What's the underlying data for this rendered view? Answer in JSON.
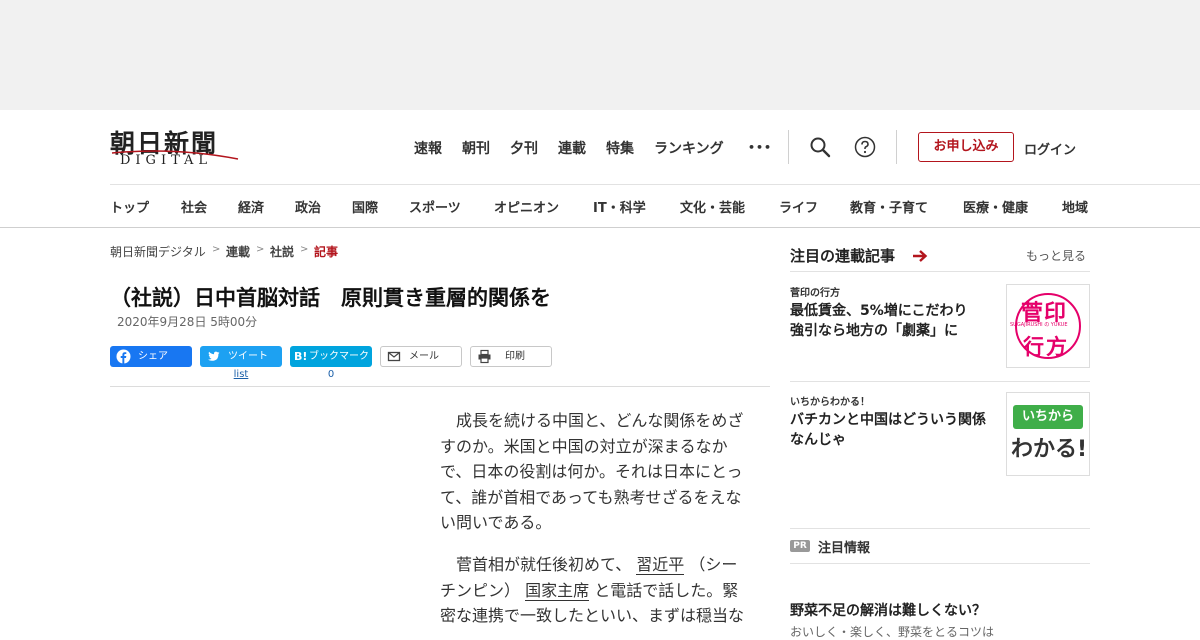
{
  "logo": {
    "main": "朝日新聞",
    "sub": "DIGITAL"
  },
  "top_nav": [
    "速報",
    "朝刊",
    "夕刊",
    "連載",
    "特集",
    "ランキング"
  ],
  "header_actions": {
    "more_glyph": "•••",
    "apply": "お申し込み",
    "login": "ログイン"
  },
  "categories": [
    "トップ",
    "社会",
    "経済",
    "政治",
    "国際",
    "スポーツ",
    "オピニオン",
    "IT・科学",
    "文化・芸能",
    "ライフ",
    "教育・子育て",
    "医療・健康",
    "地域"
  ],
  "breadcrumb": {
    "items": [
      "朝日新聞デジタル",
      "連載",
      "社説",
      "記事"
    ],
    "sep": ">"
  },
  "article": {
    "title": "（社説）日中首脳対話　原則貫き重層的関係を",
    "date": "2020年9月28日 5時00分",
    "share": {
      "facebook": "シェア",
      "twitter": "ツイート",
      "twitter_count": "list",
      "hatena_label": "ブックマーク",
      "hatena_logo": "B!",
      "hatena_count": "0",
      "mail": "メール",
      "print": "印刷"
    },
    "p1": [
      "成長を続ける中国と、どんな関係をめざ",
      "すのか。米国と中国の対立が深まるなか",
      "で、日本の役割は何か。それは日本にとっ",
      "て、誰が首相であっても熟考せざるをえな",
      "い問いである。"
    ],
    "p2_line1_pre": "菅首相が就任後初めて、",
    "p2_link1": "習近平",
    "p2_line1_post": "（シー",
    "p2_line2_pre": "チンピン）",
    "p2_link2": "国家主席",
    "p2_line2_post": "と電話で話した。緊",
    "p2_line3": "密な連携で一致したといい、まずは穏当な"
  },
  "sidebar": {
    "heading": "注目の連載記事",
    "more": "もっと見る",
    "items": [
      {
        "kicker": "菅印の行方",
        "title_l1": "最低賃金、5%増にこだわり",
        "title_l2": "強引なら地方の「劇薬」に",
        "thumb_l1": "菅印",
        "thumb_mid": "SUGAJIRUSHI の YUKUE",
        "thumb_l2": "行方"
      },
      {
        "kicker": "いちからわかる！",
        "title_l1": "バチカンと中国はどういう関係",
        "title_l2": "なんじゃ",
        "thumb_l1": "いちから",
        "thumb_l2": "わかる!"
      }
    ],
    "pr_badge": "PR",
    "pr_heading": "注目情報",
    "pr_title": "野菜不足の解消は難しくない？",
    "pr_sub": "おいしく・楽しく、野菜をとるコツは"
  },
  "colors": {
    "accent": "#b3151d",
    "facebook": "#1877f2",
    "twitter": "#1da1f2",
    "hatena": "#00a4de",
    "thumb_pink": "#e5006a",
    "thumb_green": "#3fae49"
  }
}
